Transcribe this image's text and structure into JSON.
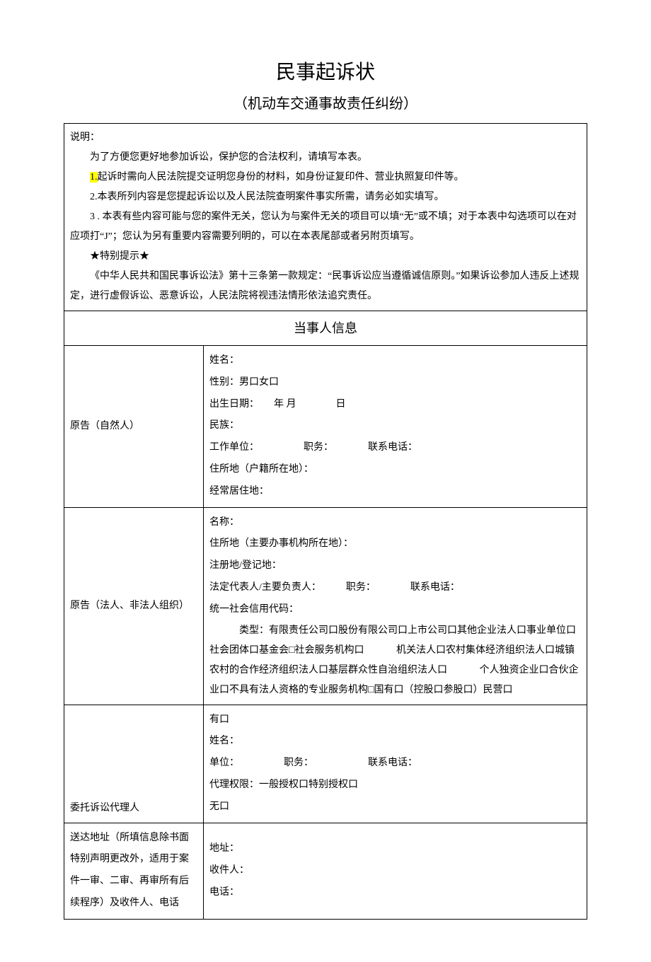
{
  "title": "民事起诉状",
  "subtitle": "（机动车交通事故责任纠纷）",
  "intro": {
    "label": "说明：",
    "line1": "为了方便您更好地参加诉讼，保护您的合法权利，请填写本表。",
    "line2_hl": "1.",
    "line2_rest": "起诉时需向人民法院提交证明您身份的材料，如身份证复印件、营业执照复印件等。",
    "line3": "2.本表所列内容是您提起诉讼以及人民法院查明案件事实所需，请务必如实填写。",
    "line4": "3 . 本表有些内容可能与您的案件无关，您认为与案件无关的项目可以填“无”或不填；对于本表中勾选项可以在对应项打“J”；您认为另有重要内容需要列明的，可以在本表尾部或者另附页填写。",
    "tip_label": "★特别提示★",
    "tip_text": "《中华人民共和国民事诉讼法》第十三条第一款规定：“民事诉讼应当遵循诚信原则。”如果诉讼参加人违反上述规定，进行虚假诉讼、恶意诉讼，人民法院将视违法情形依法追究责任。"
  },
  "section_party": "当事人信息",
  "plaintiff_natural": {
    "label": "原告（自然人）",
    "name": "姓名：",
    "gender": "性别：男口女口",
    "birth": "出生日期：　　年 月　　　　日",
    "ethnic": "民族：",
    "work": "工作单位：　　　　　职务：　　　　联系电话：",
    "domicile": "住所地（户籍所在地）：",
    "residence": "经常居住地："
  },
  "plaintiff_org": {
    "label": "原告（法人、非法人组织）",
    "name": "名称：",
    "domicile": "住所地（主要办事机构所在地）：",
    "reg": "注册地/登记地：",
    "legalrep": "法定代表人/主要负责人：　　　职务：　　　　联系电话：",
    "uscc": "统一社会信用代码：",
    "type_lead": "类型：",
    "type_line1": "有限责任公司口股份有限公司口上市公司口其他企业法人口事业单位口社会团体口基金会□社会服务机构口",
    "type_line2": "机关法人口农村集体经济组织法人口城镇农村的合作经济组织法人口基层群众性自治组织法人口",
    "type_line3": "个人独资企业口合伙企业口不具有法人资格的专业服务机构□国有口（控股口参股口）民营口"
  },
  "agent": {
    "label": "委托诉讼代理人",
    "has": "有口",
    "name": "姓名：",
    "unit": "单位：　　　　　职务：　　　　　　联系电话：",
    "auth": "代理权限：一般授权口特别授权口",
    "none": "无口"
  },
  "delivery": {
    "label": "送达地址（所填信息除书面特别声明更改外，适用于案件一审、二审、再审所有后续程序）及收件人、电话",
    "addr": "地址：",
    "recipient": "收件人：",
    "phone": "电话："
  }
}
